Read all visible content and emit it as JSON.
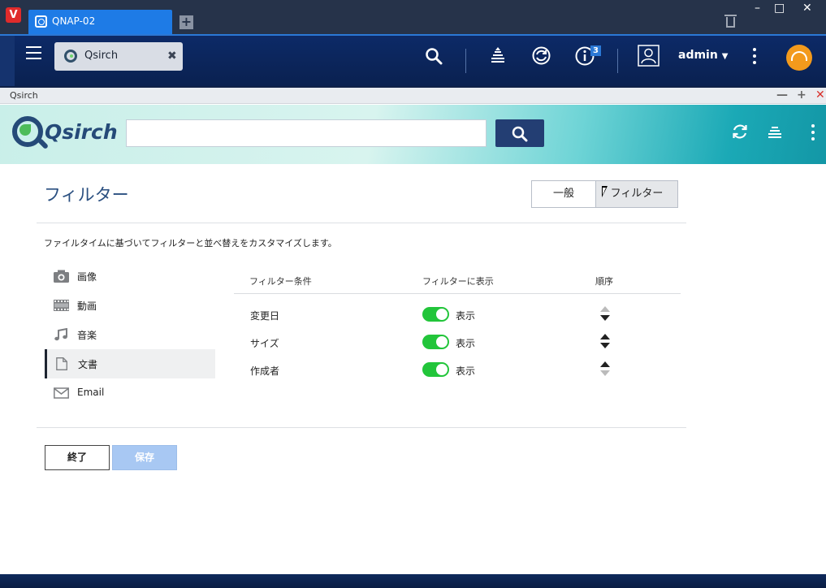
{
  "browser": {
    "tab_title": "QNAP-02"
  },
  "topnav": {
    "app_tab_label": "Qsirch",
    "notification_count": "3",
    "user": "admin"
  },
  "window": {
    "title": "Qsirch"
  },
  "header": {
    "logo_text": "Qsirch",
    "search_value": "",
    "search_placeholder": ""
  },
  "page": {
    "title": "フィルター",
    "segments": [
      "一般",
      "フィルター"
    ],
    "active_segment": "フィルター",
    "description": "ファイルタイムに基づいてフィルターと並べ替えをカスタマイズします。"
  },
  "sidebar": {
    "items": [
      {
        "label": "画像",
        "icon": "camera-icon",
        "active": false
      },
      {
        "label": "動画",
        "icon": "film-icon",
        "active": false
      },
      {
        "label": "音楽",
        "icon": "music-note-icon",
        "active": false
      },
      {
        "label": "文書",
        "icon": "document-icon",
        "active": true
      },
      {
        "label": "Email",
        "icon": "mail-icon",
        "active": false
      }
    ]
  },
  "table": {
    "headers": [
      "フィルター条件",
      "フィルターに表示",
      "順序"
    ],
    "rows": [
      {
        "name": "変更日",
        "show": true,
        "show_label": "表示"
      },
      {
        "name": "サイズ",
        "show": true,
        "show_label": "表示"
      },
      {
        "name": "作成者",
        "show": true,
        "show_label": "表示"
      }
    ]
  },
  "footer": {
    "end_label": "終了",
    "save_label": "保存",
    "save_enabled": false
  },
  "colors": {
    "accent_blue": "#1e7be6",
    "toggle_green": "#22c53a",
    "title_blue": "#2a4f80",
    "save_disabled": "#a8c8f3"
  }
}
